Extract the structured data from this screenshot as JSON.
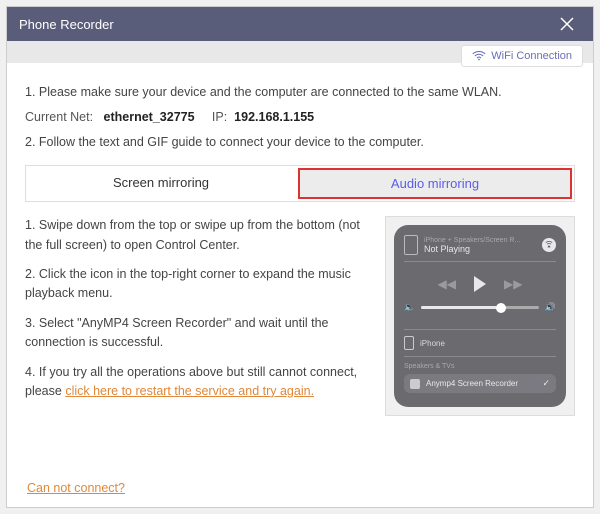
{
  "titlebar": {
    "title": "Phone Recorder"
  },
  "wifi": {
    "label": "WiFi Connection"
  },
  "intro": {
    "line1": "1. Please make sure your device and the computer are connected to the same WLAN.",
    "netLabel": "Current Net:",
    "netValue": "ethernet_32775",
    "ipLabel": "IP:",
    "ipValue": "192.168.1.155",
    "line2": "2. Follow the text and GIF guide to connect your device to the computer."
  },
  "tabs": {
    "screen": "Screen mirroring",
    "audio": "Audio mirroring"
  },
  "steps": {
    "s1": "1. Swipe down from the top or swipe up from the bottom (not the full screen) to open Control Center.",
    "s2": "2. Click the icon in the top-right corner to expand the music playback menu.",
    "s3": "3. Select \"AnyMP4 Screen Recorder\" and wait until the connection is successful.",
    "s4a": "4. If you try all the operations above but still cannot connect, please ",
    "s4link": "click here to restart the service and try again."
  },
  "controlCenter": {
    "sourceLine": "iPhone + Speakers/Screen R...",
    "notPlaying": "Not Playing",
    "deviceLabel": "iPhone",
    "sectionLabel": "Speakers & TVs",
    "recorderItem": "Anymp4 Screen Recorder"
  },
  "footer": {
    "cannotConnect": "Can not connect?"
  }
}
